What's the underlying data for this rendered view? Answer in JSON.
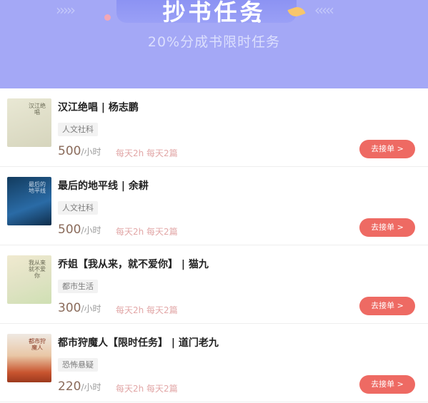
{
  "banner": {
    "title": "抄书任务",
    "subtitle": "20%分成书限时任务"
  },
  "books": [
    {
      "title": "汉江绝唱 | 杨志鹏",
      "tag": "人文社科",
      "price": "500",
      "unit": "/小时",
      "schedule": "每天2h 每天2篇",
      "cover_text": "汉江绝唱",
      "action": "去接单 >"
    },
    {
      "title": "最后的地平线 | 余耕",
      "tag": "人文社科",
      "price": "500",
      "unit": "/小时",
      "schedule": "每天2h 每天2篇",
      "cover_text": "最后的地平线",
      "action": "去接单 >"
    },
    {
      "title": "乔姐【我从来，就不爱你】 | 猫九",
      "tag": "都市生活",
      "price": "300",
      "unit": "/小时",
      "schedule": "每天2h 每天2篇",
      "cover_text": "我从来就不爱你",
      "action": "去接单 >"
    },
    {
      "title": "都市狩魔人【限时任务】 | 道门老九",
      "tag": "恐怖悬疑",
      "price": "220",
      "unit": "/小时",
      "schedule": "每天2h 每天2篇",
      "cover_text": "都市狩魔人",
      "action": "去接单 >"
    }
  ],
  "colors": {
    "banner_bg": "#a4a8f6",
    "button_bg": "#ee6a63",
    "price": "#8a6b5b",
    "schedule": "#e2a7a7"
  }
}
